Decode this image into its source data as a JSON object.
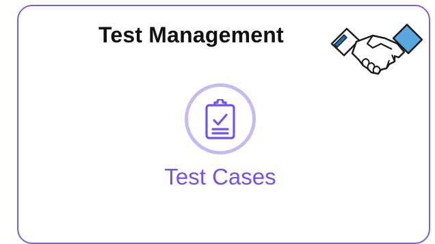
{
  "panel": {
    "title": "Test Management",
    "header_icon": "handshake-icon",
    "accent_color": "#7b5ce6"
  },
  "tiles": [
    {
      "label": "Test Cases",
      "icon": "clipboard-check-icon",
      "color": "#7550ee"
    }
  ]
}
